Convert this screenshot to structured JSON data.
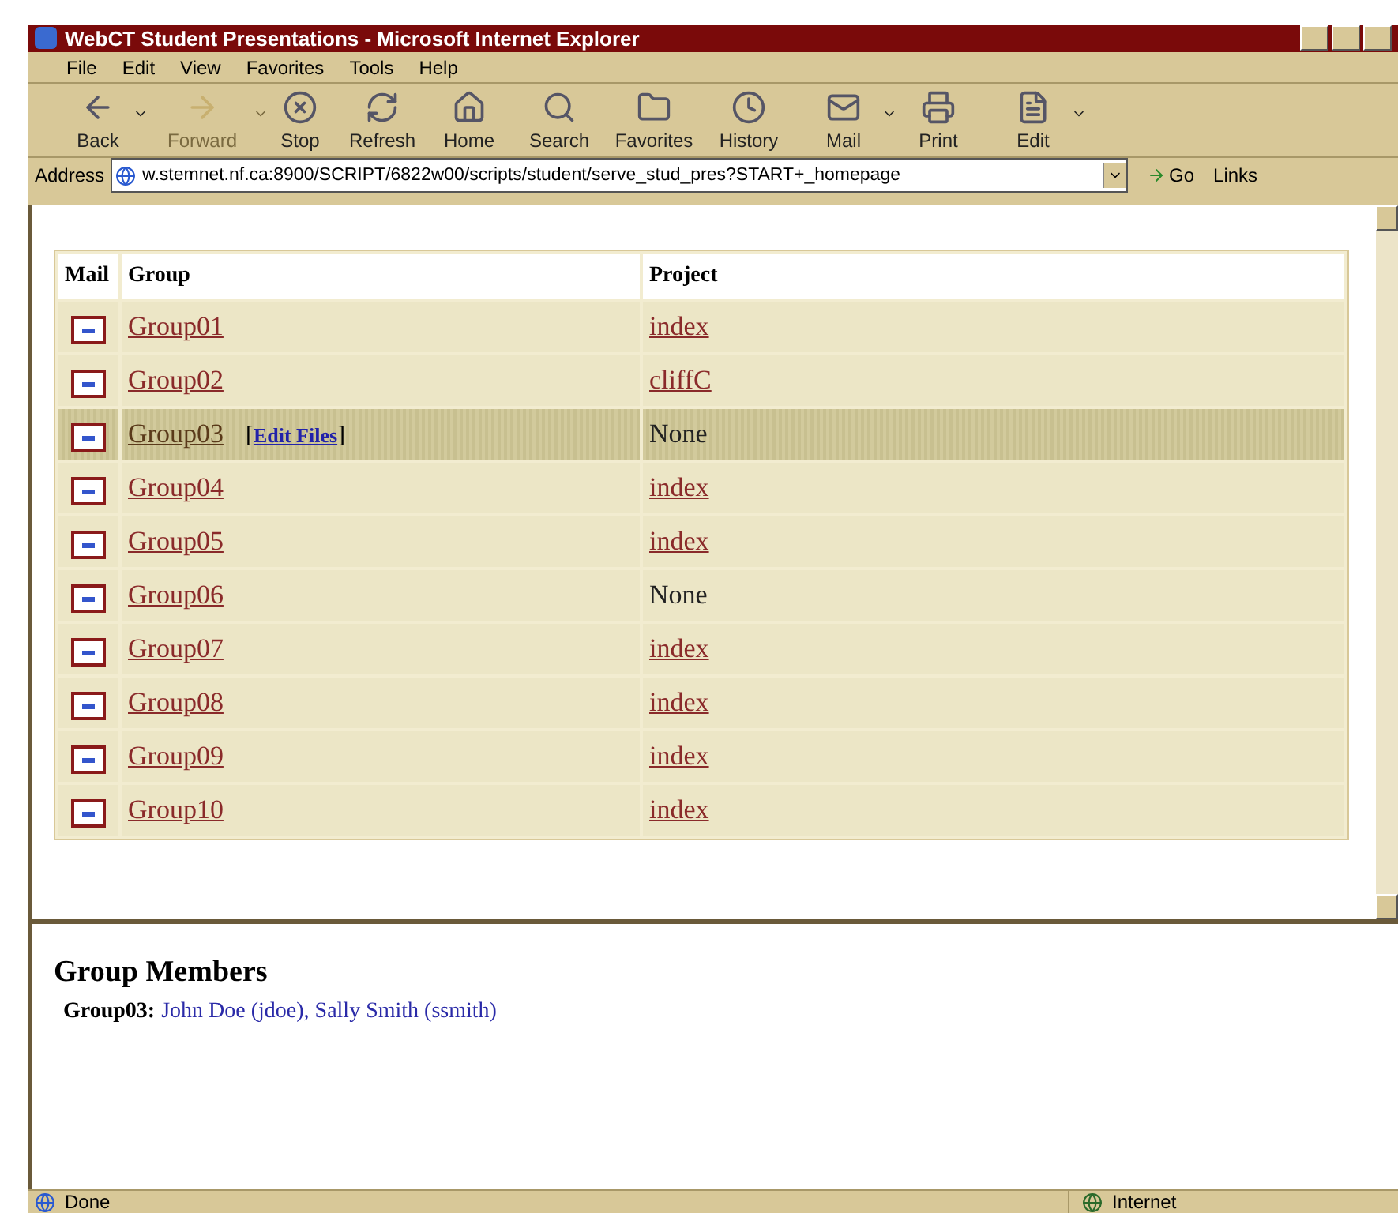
{
  "window": {
    "title": "WebCT Student Presentations - Microsoft Internet Explorer"
  },
  "menu": [
    "File",
    "Edit",
    "View",
    "Favorites",
    "Tools",
    "Help"
  ],
  "toolbar": [
    {
      "kind": "back",
      "label": "Back",
      "disabled": false,
      "dropdown": true
    },
    {
      "kind": "forward",
      "label": "Forward",
      "disabled": true,
      "dropdown": true
    },
    {
      "kind": "stop",
      "label": "Stop",
      "disabled": false,
      "dropdown": false
    },
    {
      "kind": "refresh",
      "label": "Refresh",
      "disabled": false,
      "dropdown": false
    },
    {
      "kind": "home",
      "label": "Home",
      "disabled": false,
      "dropdown": false
    },
    {
      "kind": "search",
      "label": "Search",
      "disabled": false,
      "dropdown": false
    },
    {
      "kind": "favorites",
      "label": "Favorites",
      "disabled": false,
      "dropdown": false
    },
    {
      "kind": "history",
      "label": "History",
      "disabled": false,
      "dropdown": false
    },
    {
      "kind": "mail",
      "label": "Mail",
      "disabled": false,
      "dropdown": true
    },
    {
      "kind": "print",
      "label": "Print",
      "disabled": false,
      "dropdown": false
    },
    {
      "kind": "edit",
      "label": "Edit",
      "disabled": false,
      "dropdown": true
    }
  ],
  "address": {
    "label": "Address",
    "value": "w.stemnet.nf.ca:8900/SCRIPT/6822w00/scripts/student/serve_stud_pres?START+_homepage",
    "go": "Go",
    "links": "Links"
  },
  "table": {
    "columns": [
      "Mail",
      "Group",
      "Project"
    ],
    "rows": [
      {
        "group": "Group01",
        "project": "index",
        "project_linked": true,
        "selected": false
      },
      {
        "group": "Group02",
        "project": "cliffC",
        "project_linked": true,
        "selected": false
      },
      {
        "group": "Group03",
        "project": "None",
        "project_linked": false,
        "selected": true,
        "edit_files": {
          "open": "[",
          "label": "Edit Files",
          "close": "]"
        }
      },
      {
        "group": "Group04",
        "project": "index",
        "project_linked": true,
        "selected": false
      },
      {
        "group": "Group05",
        "project": "index",
        "project_linked": true,
        "selected": false
      },
      {
        "group": "Group06",
        "project": "None",
        "project_linked": false,
        "selected": false
      },
      {
        "group": "Group07",
        "project": "index",
        "project_linked": true,
        "selected": false
      },
      {
        "group": "Group08",
        "project": "index",
        "project_linked": true,
        "selected": false
      },
      {
        "group": "Group09",
        "project": "index",
        "project_linked": true,
        "selected": false
      },
      {
        "group": "Group10",
        "project": "index",
        "project_linked": true,
        "selected": false
      }
    ]
  },
  "members": {
    "heading": "Group Members",
    "group": "Group03:",
    "names": "John Doe (jdoe), Sally Smith (ssmith)"
  },
  "status_bar": {
    "text": "Done",
    "zone": "Internet"
  }
}
